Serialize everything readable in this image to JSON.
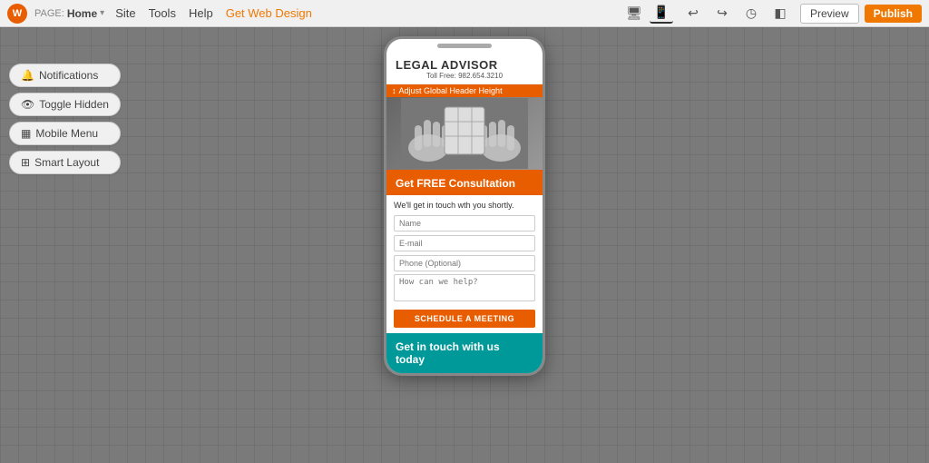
{
  "toolbar": {
    "logo_text": "W",
    "page_label": "PAGE:",
    "page_name": "Home",
    "nav": {
      "site": "Site",
      "tools": "Tools",
      "help": "Help",
      "get_web_design": "Get Web Design"
    },
    "preview_label": "Preview",
    "publish_label": "Publish"
  },
  "left_panel": {
    "notifications_label": "Notifications",
    "toggle_hidden_label": "Toggle Hidden",
    "mobile_menu_label": "Mobile Menu",
    "smart_layout_label": "Smart Layout"
  },
  "site": {
    "logo_text": "LEGAL ADVISOR",
    "phone_label": "Toll Free:",
    "phone_number": "982.654.3210",
    "header_adjust_tooltip": "Adjust Global Header Height",
    "consultation": {
      "title": "Get FREE Consultation",
      "description": "We'll get in touch wth you shortly.",
      "name_placeholder": "Name",
      "email_placeholder": "E-mail",
      "phone_placeholder": "Phone (Optional)",
      "message_placeholder": "How can we help?",
      "schedule_btn": "SCHEDULE A MEETING"
    },
    "get_in_touch": {
      "line1": "Get in touch with us",
      "line2": "today"
    }
  }
}
